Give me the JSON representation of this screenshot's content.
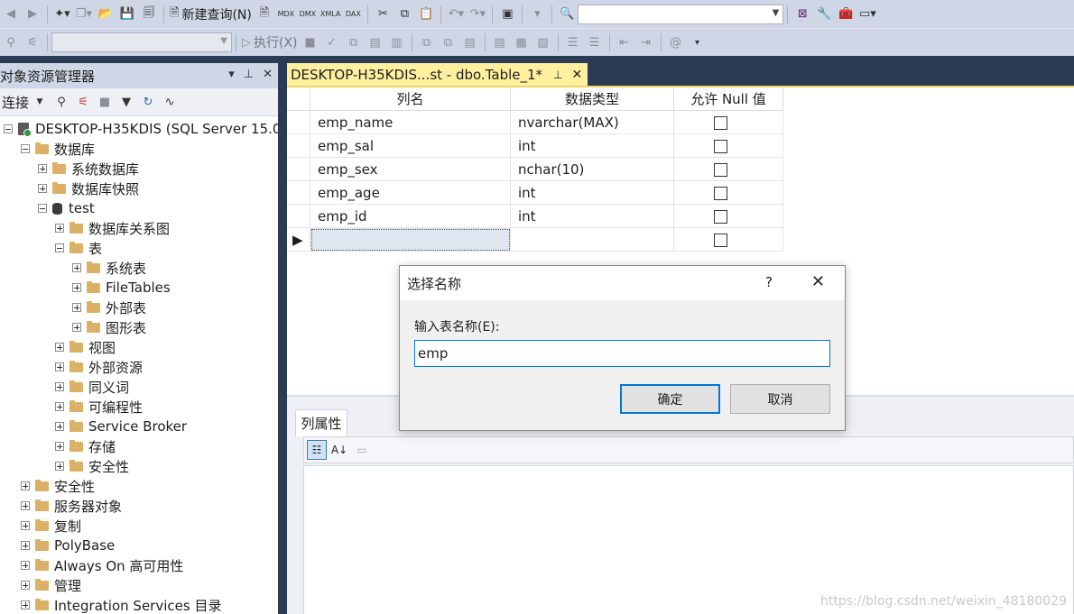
{
  "toolbar1": {
    "new_query_label": "新建查询(N)",
    "mdx": "MDX",
    "dmx": "DMX",
    "xmla": "XMLA",
    "dax": "DAX"
  },
  "toolbar2": {
    "execute_label": "执行(X)"
  },
  "object_explorer": {
    "title": "对象资源管理器",
    "connect_label": "连接",
    "tree": [
      {
        "label": "DESKTOP-H35KDIS (SQL Server 15.0.",
        "level": 0,
        "icon": "server",
        "toggle": "minus"
      },
      {
        "label": "数据库",
        "level": 1,
        "icon": "folder",
        "toggle": "minus"
      },
      {
        "label": "系统数据库",
        "level": 2,
        "icon": "folder",
        "toggle": "plus"
      },
      {
        "label": "数据库快照",
        "level": 2,
        "icon": "folder",
        "toggle": "plus"
      },
      {
        "label": "test",
        "level": 2,
        "icon": "database",
        "toggle": "minus"
      },
      {
        "label": "数据库关系图",
        "level": 3,
        "icon": "folder",
        "toggle": "plus"
      },
      {
        "label": "表",
        "level": 3,
        "icon": "folder",
        "toggle": "minus"
      },
      {
        "label": "系统表",
        "level": 4,
        "icon": "folder",
        "toggle": "plus"
      },
      {
        "label": "FileTables",
        "level": 4,
        "icon": "folder",
        "toggle": "plus"
      },
      {
        "label": "外部表",
        "level": 4,
        "icon": "folder",
        "toggle": "plus"
      },
      {
        "label": "图形表",
        "level": 4,
        "icon": "folder",
        "toggle": "plus"
      },
      {
        "label": "视图",
        "level": 3,
        "icon": "folder",
        "toggle": "plus"
      },
      {
        "label": "外部资源",
        "level": 3,
        "icon": "folder",
        "toggle": "plus"
      },
      {
        "label": "同义词",
        "level": 3,
        "icon": "folder",
        "toggle": "plus"
      },
      {
        "label": "可编程性",
        "level": 3,
        "icon": "folder",
        "toggle": "plus"
      },
      {
        "label": "Service Broker",
        "level": 3,
        "icon": "folder",
        "toggle": "plus"
      },
      {
        "label": "存储",
        "level": 3,
        "icon": "folder",
        "toggle": "plus"
      },
      {
        "label": "安全性",
        "level": 3,
        "icon": "folder",
        "toggle": "plus"
      },
      {
        "label": "安全性",
        "level": 1,
        "icon": "folder",
        "toggle": "plus"
      },
      {
        "label": "服务器对象",
        "level": 1,
        "icon": "folder",
        "toggle": "plus"
      },
      {
        "label": "复制",
        "level": 1,
        "icon": "folder",
        "toggle": "plus"
      },
      {
        "label": "PolyBase",
        "level": 1,
        "icon": "folder",
        "toggle": "plus"
      },
      {
        "label": "Always On 高可用性",
        "level": 1,
        "icon": "folder",
        "toggle": "plus"
      },
      {
        "label": "管理",
        "level": 1,
        "icon": "folder",
        "toggle": "plus"
      },
      {
        "label": "Integration Services 目录",
        "level": 1,
        "icon": "folder",
        "toggle": "plus"
      }
    ]
  },
  "document_tab": {
    "title": "DESKTOP-H35KDIS...st - dbo.Table_1*"
  },
  "design_grid": {
    "headers": [
      "列名",
      "数据类型",
      "允许 Null 值"
    ],
    "rows": [
      {
        "name": "emp_name",
        "type": "nvarchar(MAX)",
        "allow_null": false
      },
      {
        "name": "emp_sal",
        "type": "int",
        "allow_null": false
      },
      {
        "name": "emp_sex",
        "type": "nchar(10)",
        "allow_null": false
      },
      {
        "name": "emp_age",
        "type": "int",
        "allow_null": false
      },
      {
        "name": "emp_id",
        "type": "int",
        "allow_null": false
      },
      {
        "name": "",
        "type": "",
        "allow_null": false
      }
    ]
  },
  "properties": {
    "tab_label": "列属性"
  },
  "dialog": {
    "title": "选择名称",
    "help": "?",
    "label": "输入表名称(E):",
    "input_value": "emp",
    "ok_label": "确定",
    "cancel_label": "取消"
  },
  "watermark": "https://blog.csdn.net/weixin_48180029",
  "colors": {
    "dark_frame": "#2b3a55",
    "toolbar": "#cfd6e5",
    "active_tab": "#fff0a0",
    "accent": "#0078d7"
  }
}
